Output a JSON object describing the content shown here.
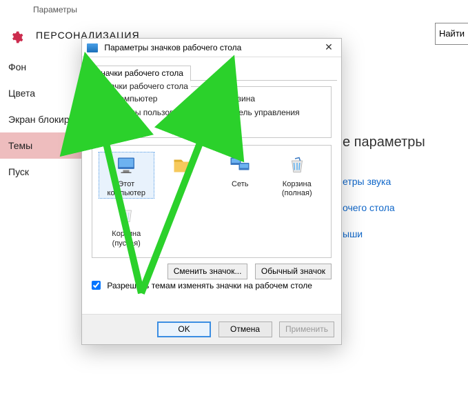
{
  "settings": {
    "app_title": "Параметры",
    "section": "ПЕРСОНАЛИЗАЦИЯ",
    "find": "Найти",
    "sidebar": [
      {
        "label": "Фон",
        "selected": false
      },
      {
        "label": "Цвета",
        "selected": false
      },
      {
        "label": "Экран блокировки",
        "selected": false
      },
      {
        "label": "Темы",
        "selected": true
      },
      {
        "label": "Пуск",
        "selected": false
      }
    ],
    "right_heading": "е параметры",
    "right_links": [
      "етры звука",
      "очего стола",
      "ыши"
    ]
  },
  "dialog": {
    "title": "Параметры значков рабочего стола",
    "tab": "Значки рабочего стола",
    "group_title": "Значки рабочего стола",
    "checkboxes": {
      "computer": {
        "label": "Компьютер",
        "checked": false
      },
      "recycle": {
        "label": "Корзина",
        "checked": false
      },
      "userfiles": {
        "label": "Файлы пользователя",
        "checked": false
      },
      "control_panel": {
        "label": "Панель управления",
        "checked": false
      },
      "network": {
        "label": "Сеть",
        "checked": false
      }
    },
    "icons": [
      {
        "id": "this_pc",
        "label": "Этот компьютер",
        "selected": true
      },
      {
        "id": "userfolder",
        "label": "",
        "selected": false
      },
      {
        "id": "network",
        "label": "Сеть",
        "selected": false
      },
      {
        "id": "bin_full",
        "label": "Корзина (полная)",
        "selected": false
      },
      {
        "id": "bin_empty",
        "label": "Корзина (пустая)",
        "selected": false
      }
    ],
    "change_icon": "Сменить значок...",
    "default_icon": "Обычный значок",
    "allow_themes": "Разрешить темам изменять значки на рабочем столе",
    "allow_checked": true,
    "ok": "OK",
    "cancel": "Отмена",
    "apply": "Применить"
  },
  "annotation": {
    "color": "#2bd12b"
  }
}
